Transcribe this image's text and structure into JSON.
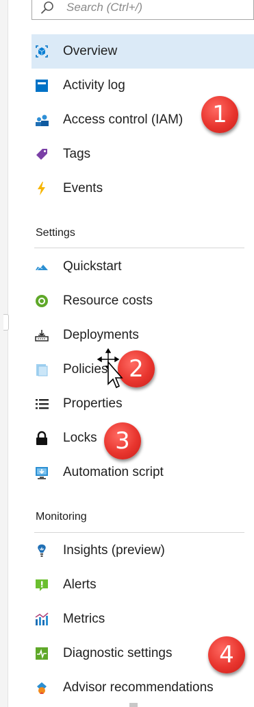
{
  "search": {
    "placeholder": "Search (Ctrl+/)"
  },
  "nav_top": [
    {
      "label": "Overview",
      "icon": "overview-icon",
      "selected": true
    },
    {
      "label": "Activity log",
      "icon": "activity-log-icon"
    },
    {
      "label": "Access control (IAM)",
      "icon": "iam-icon"
    },
    {
      "label": "Tags",
      "icon": "tag-icon"
    },
    {
      "label": "Events",
      "icon": "lightning-icon"
    }
  ],
  "settings": {
    "header": "Settings",
    "items": [
      {
        "label": "Quickstart",
        "icon": "quickstart-cloud-icon"
      },
      {
        "label": "Resource costs",
        "icon": "resource-costs-icon"
      },
      {
        "label": "Deployments",
        "icon": "deployments-icon"
      },
      {
        "label": "Policies",
        "icon": "policies-icon"
      },
      {
        "label": "Properties",
        "icon": "properties-list-icon"
      },
      {
        "label": "Locks",
        "icon": "lock-icon"
      },
      {
        "label": "Automation script",
        "icon": "automation-script-icon"
      }
    ]
  },
  "monitoring": {
    "header": "Monitoring",
    "items": [
      {
        "label": "Insights (preview)",
        "icon": "insights-bulb-icon"
      },
      {
        "label": "Alerts",
        "icon": "alert-icon"
      },
      {
        "label": "Metrics",
        "icon": "metrics-chart-icon"
      },
      {
        "label": "Diagnostic settings",
        "icon": "diagnostic-icon"
      },
      {
        "label": "Advisor recommendations",
        "icon": "advisor-icon"
      }
    ]
  },
  "callouts": [
    "1",
    "2",
    "3",
    "4"
  ],
  "colors": {
    "selected_bg": "#dbeaf7",
    "callout_red": "#e8352e",
    "accent_blue": "#0072c6"
  }
}
